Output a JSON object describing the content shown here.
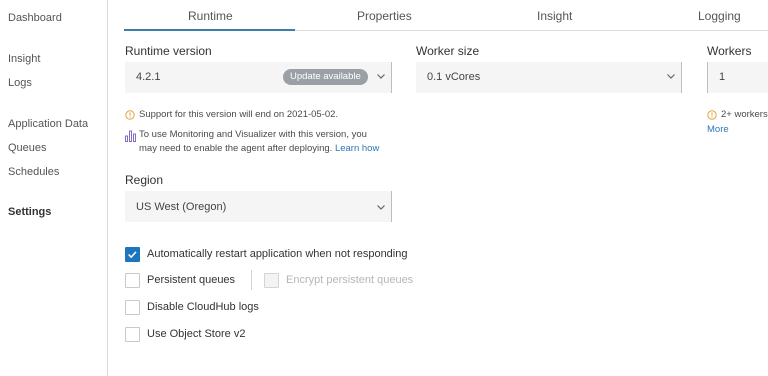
{
  "sidebar": {
    "items": [
      {
        "label": "Dashboard"
      },
      {
        "label": "Insight"
      },
      {
        "label": "Logs"
      },
      {
        "label": "Application Data"
      },
      {
        "label": "Queues"
      },
      {
        "label": "Schedules"
      },
      {
        "label": "Settings"
      }
    ],
    "active": "Settings"
  },
  "tabs": {
    "items": [
      {
        "label": "Runtime"
      },
      {
        "label": "Properties"
      },
      {
        "label": "Insight"
      },
      {
        "label": "Logging"
      }
    ],
    "active": "Runtime",
    "accent_color": "#3d7fa8"
  },
  "runtime": {
    "label": "Runtime version",
    "value": "4.2.1",
    "badge": "Update available",
    "support_notice": "Support for this version will end on 2021-05-02.",
    "monitoring_notice_line1": "To use Monitoring and Visualizer with this version, you",
    "monitoring_notice_line2": "may need to enable the agent after deploying.",
    "learn_how": "Learn how"
  },
  "worker_size": {
    "label": "Worker size",
    "value": "0.1 vCores"
  },
  "workers": {
    "label": "Workers",
    "value": "1",
    "notice": "2+ workers",
    "more": "More"
  },
  "region": {
    "label": "Region",
    "value": "US West (Oregon)"
  },
  "options": {
    "auto_restart": {
      "label": "Automatically restart application when not responding",
      "checked": true
    },
    "persistent_queues": {
      "label": "Persistent queues",
      "checked": false
    },
    "encrypt_queues": {
      "label": "Encrypt persistent queues",
      "checked": false,
      "disabled": true
    },
    "disable_logs": {
      "label": "Disable CloudHub logs",
      "checked": false
    },
    "object_store": {
      "label": "Use Object Store v2",
      "checked": false
    }
  },
  "icons": {
    "warning": "info-circle-icon",
    "monitoring": "bar-chart-icon",
    "dropdown": "chevron-down-icon",
    "check": "checkmark-icon"
  },
  "colors": {
    "checkbox_checked": "#1d75bd",
    "warning": "#e8a33d",
    "link": "#2b78b8"
  }
}
